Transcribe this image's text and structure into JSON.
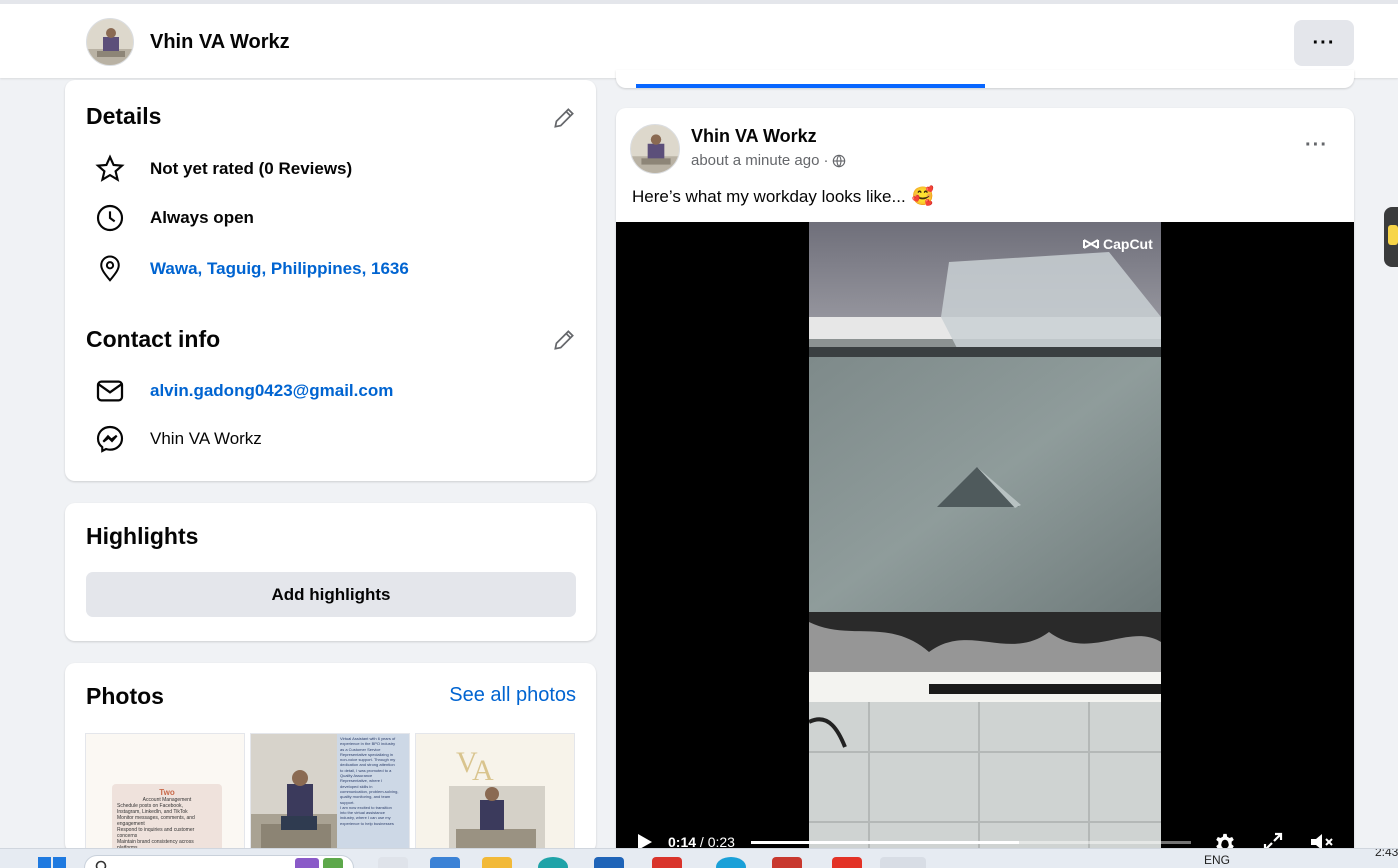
{
  "header": {
    "page_name": "Vhin VA Workz",
    "more_label": "···"
  },
  "details": {
    "title": "Details",
    "rating": "Not yet rated (0 Reviews)",
    "hours": "Always open",
    "address": "Wawa, Taguig, Philippines, 1636"
  },
  "contact": {
    "title": "Contact info",
    "email": "alvin.gadong0423@gmail.com",
    "messenger": "Vhin VA Workz"
  },
  "highlights": {
    "title": "Highlights",
    "add_label": "Add highlights"
  },
  "photos": {
    "title": "Photos",
    "see_all": "See all photos",
    "thumb1_heading": "Two",
    "thumb1_lines": [
      "Account Management",
      "Schedule posts on Facebook,",
      "Instagram, LinkedIn, and TikTok",
      "Monitor messages, comments, and",
      "engagement",
      "Respond to inquiries and customer",
      "concerns",
      "Maintain brand consistency across",
      "platforms"
    ],
    "thumb2_lines": [
      "Virtual Assistant with 6 years of",
      "experience in the BPO industry",
      "as a Customer Service",
      "Representative specializing in",
      "non-voice support. Through my",
      "dedication and strong attention",
      "to detail, I was promoted to a",
      "Quality Assurance",
      "Representative, where I",
      "developed skills in",
      "communication, problem-solving,",
      "quality monitoring, and team",
      "support.",
      "I am now excited to transition",
      "into the virtual assistance",
      "industry, where I can use my",
      "experience to help businesses"
    ]
  },
  "post": {
    "author": "Vhin VA Workz",
    "time": "about a minute ago",
    "separator": "·",
    "text": "Here’s what my workday looks like...",
    "emoji": "🥰",
    "more_label": "···",
    "video": {
      "watermark": "CapCut",
      "current_time": "0:14",
      "separator": " / ",
      "duration": "0:23",
      "progress": 0.61
    }
  },
  "taskbar": {
    "language": "ENG",
    "clock": "2:43"
  }
}
